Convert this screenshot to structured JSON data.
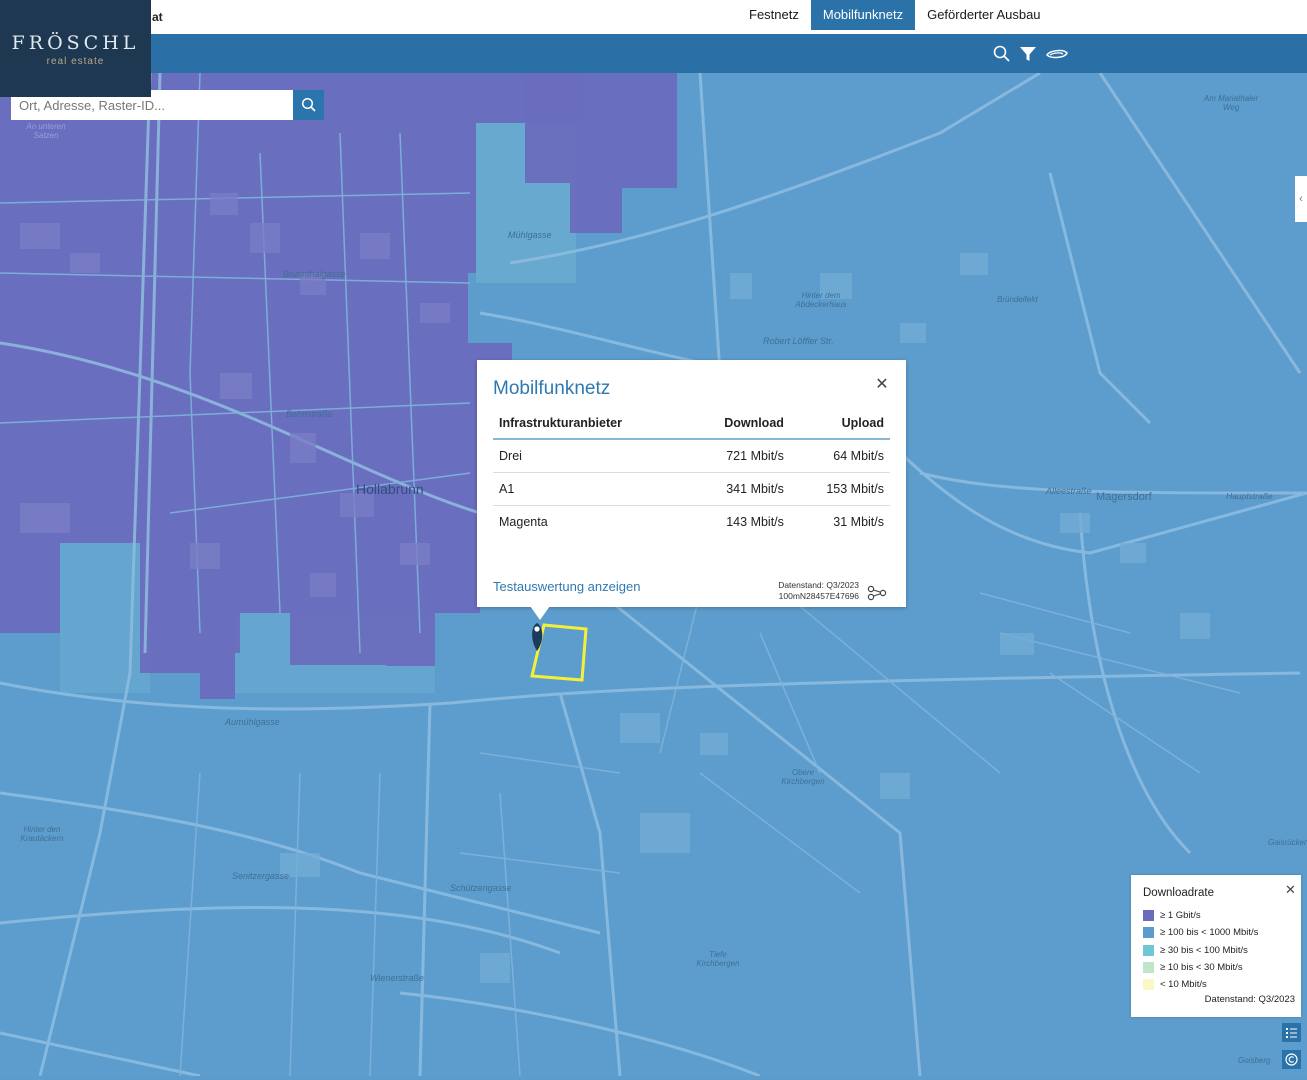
{
  "header": {
    "title_fragment": "at",
    "tabs": [
      {
        "label": "Festnetz",
        "active": false
      },
      {
        "label": "Mobilfunknetz",
        "active": true
      },
      {
        "label": "Geförderter Ausbau",
        "active": false
      }
    ]
  },
  "toolbar": {
    "icons": [
      "search-icon",
      "filter-icon",
      "layers-icon"
    ]
  },
  "logo": {
    "brand": "FRÖSCHL",
    "tagline": "real estate"
  },
  "search": {
    "placeholder": "Ort, Adresse, Raster-ID..."
  },
  "map": {
    "town": "Hollabrunn",
    "labels": {
      "magersdorf": "Magersdorf",
      "muehlgasse": "Mühlgasse",
      "bahnstrasse": "Bahnstraße",
      "brunnthalgasse": "Brunnthalgasse",
      "aumuehlgasse": "Aumühlgasse",
      "alleestrasse": "Alleestraße",
      "bruendelfeld": "Bründelfeld",
      "schuetzengasse": "Schützengasse",
      "senitzergasse": "Senitzergasse",
      "wienerstrasse": "Wienerstraße",
      "tiefe_kirchbergen": "Tiefe Kirchbergen",
      "hinter_krautaeckern": "Hinter den Krautäckern",
      "am_mariathaler_weg": "Am Mariathaler Weg",
      "goisberg": "Goisberg",
      "gaisruecken": "Gaisrücken",
      "robert_loeffler": "Robert Löffler Str.",
      "hauptstrasse": "Hauptstraße",
      "obere_kirchbergen": "Obere Kirchbergen",
      "hinter_abdeckerhaus": "Hinter dem Abdeckerhaus",
      "an_unteren_satzen": "An unteren Satzen"
    }
  },
  "popup": {
    "title": "Mobilfunknetz",
    "columns": [
      "Infrastrukturanbieter",
      "Download",
      "Upload"
    ],
    "rows": [
      {
        "provider": "Drei",
        "download": "721 Mbit/s",
        "upload": "64 Mbit/s"
      },
      {
        "provider": "A1",
        "download": "341 Mbit/s",
        "upload": "153 Mbit/s"
      },
      {
        "provider": "Magenta",
        "download": "143 Mbit/s",
        "upload": "31 Mbit/s"
      }
    ],
    "link": "Testauswertung anzeigen",
    "data_date": "Datenstand: Q3/2023",
    "raster_id": "100mN28457E47696"
  },
  "legend": {
    "title": "Downloadrate",
    "items": [
      {
        "label": "≥ 1 Gbit/s",
        "color": "#6a6bbd"
      },
      {
        "label": "≥ 100 bis < 1000 Mbit/s",
        "color": "#5b9ccd"
      },
      {
        "label": "≥ 30 bis < 100 Mbit/s",
        "color": "#6fc7d6"
      },
      {
        "label": "≥ 10 bis < 30 Mbit/s",
        "color": "#bfe6c8"
      },
      {
        "label": "< 10 Mbit/s",
        "color": "#fbf8c8"
      }
    ],
    "data_date": "Datenstand: Q3/2023"
  },
  "colors": {
    "accent": "#2a72a8",
    "gigabit": "#6a6bbd",
    "hundred_plus": "#5b9ccd",
    "highlight": "#f4f03a"
  }
}
